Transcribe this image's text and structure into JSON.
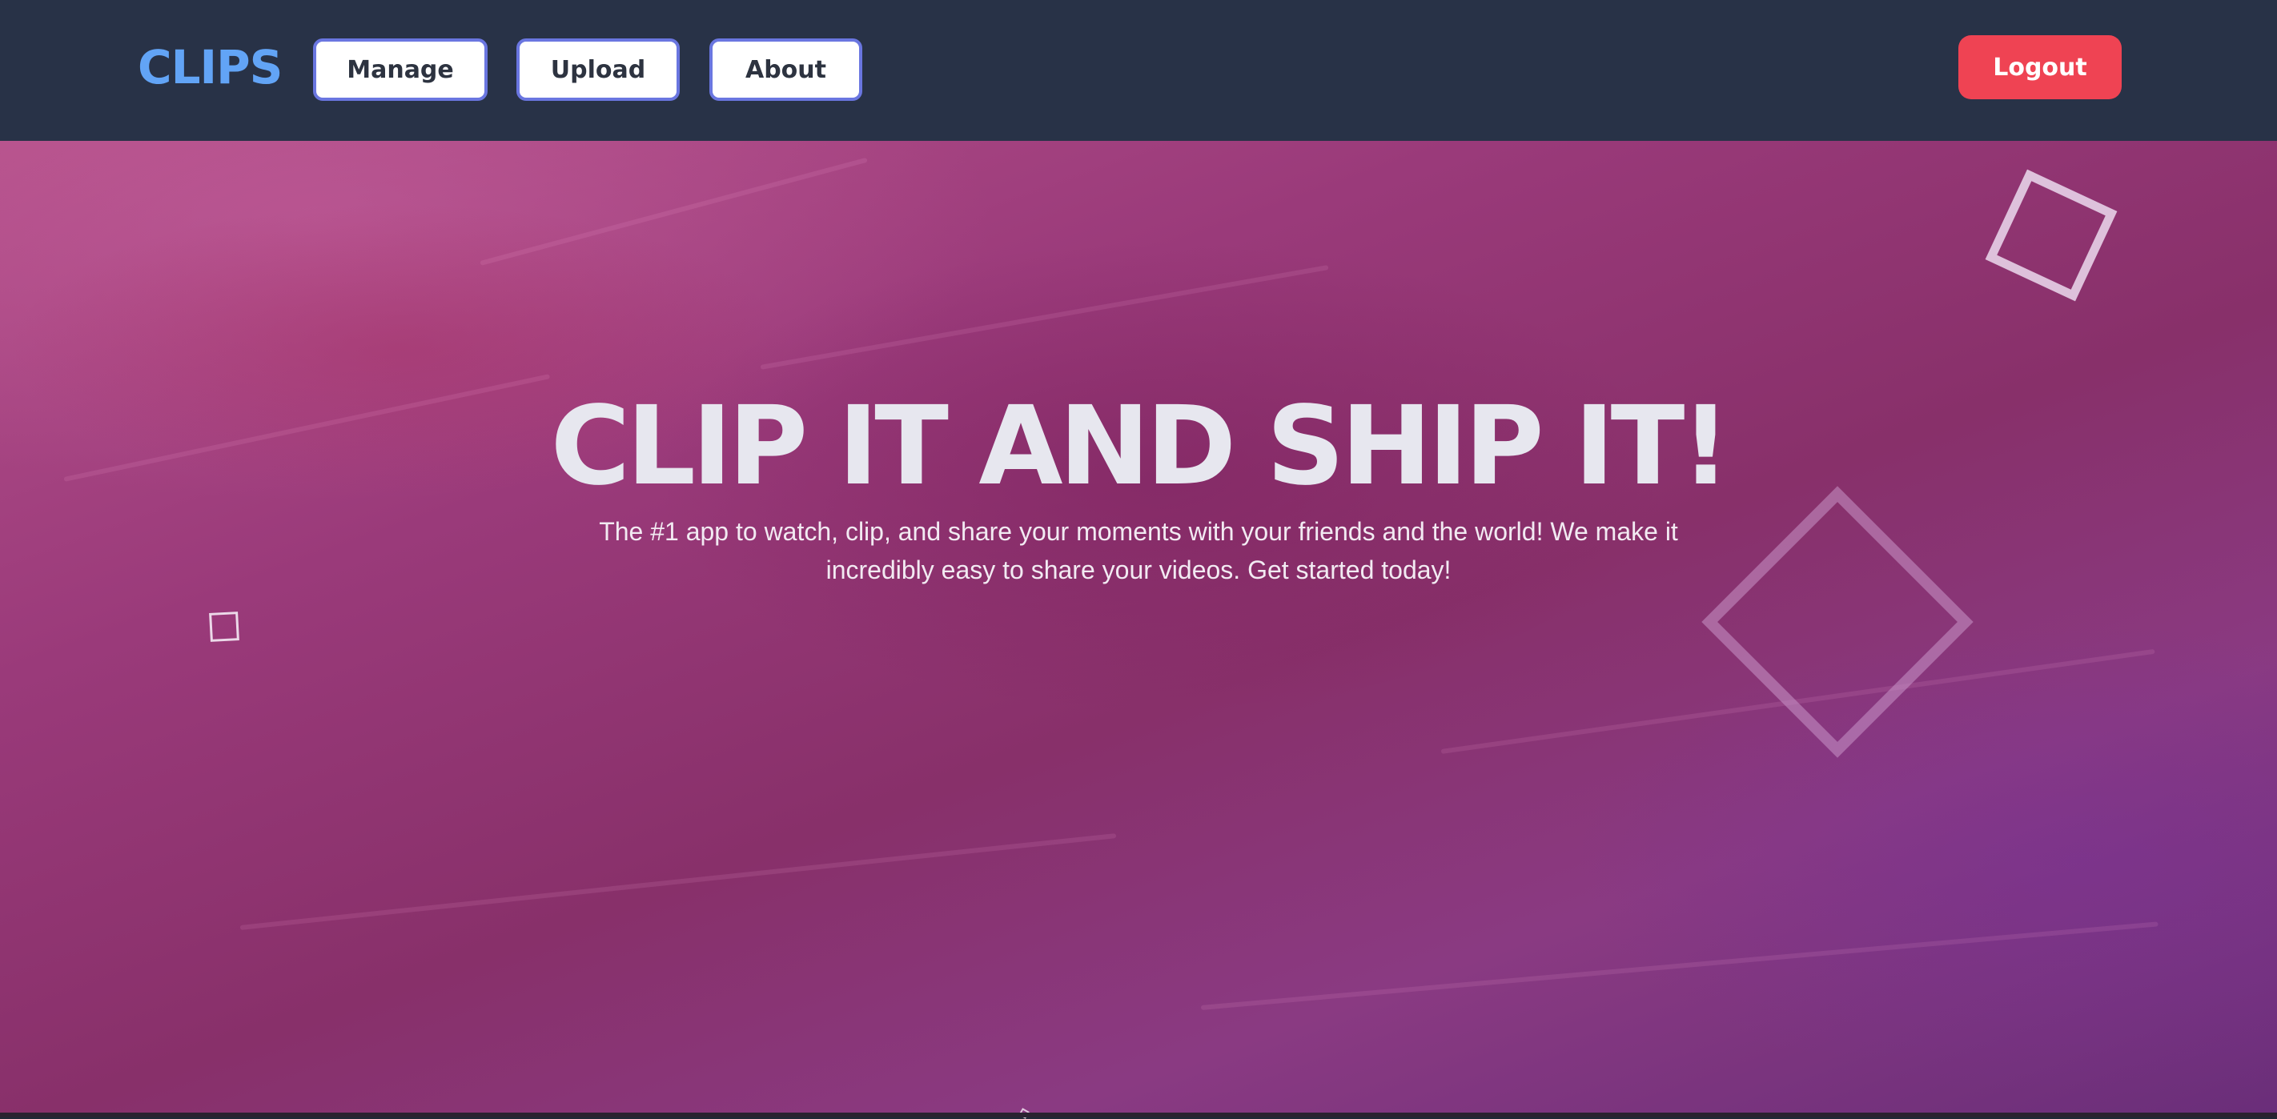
{
  "brand": {
    "logo_text": "CLIPS",
    "colors": {
      "navbar_bg": "#283247",
      "logo": "#62a4f6",
      "nav_button_border": "#6a76e0",
      "logout_bg": "#ef4353"
    }
  },
  "nav": {
    "items": [
      {
        "label": "Manage"
      },
      {
        "label": "Upload"
      },
      {
        "label": "About"
      }
    ],
    "logout_label": "Logout"
  },
  "hero": {
    "title": "CLIP IT AND SHIP IT!",
    "subtitle": "The #1 app to watch, clip, and share your moments with your friends and the world! We make it incredibly easy to share your videos. Get started today!"
  }
}
